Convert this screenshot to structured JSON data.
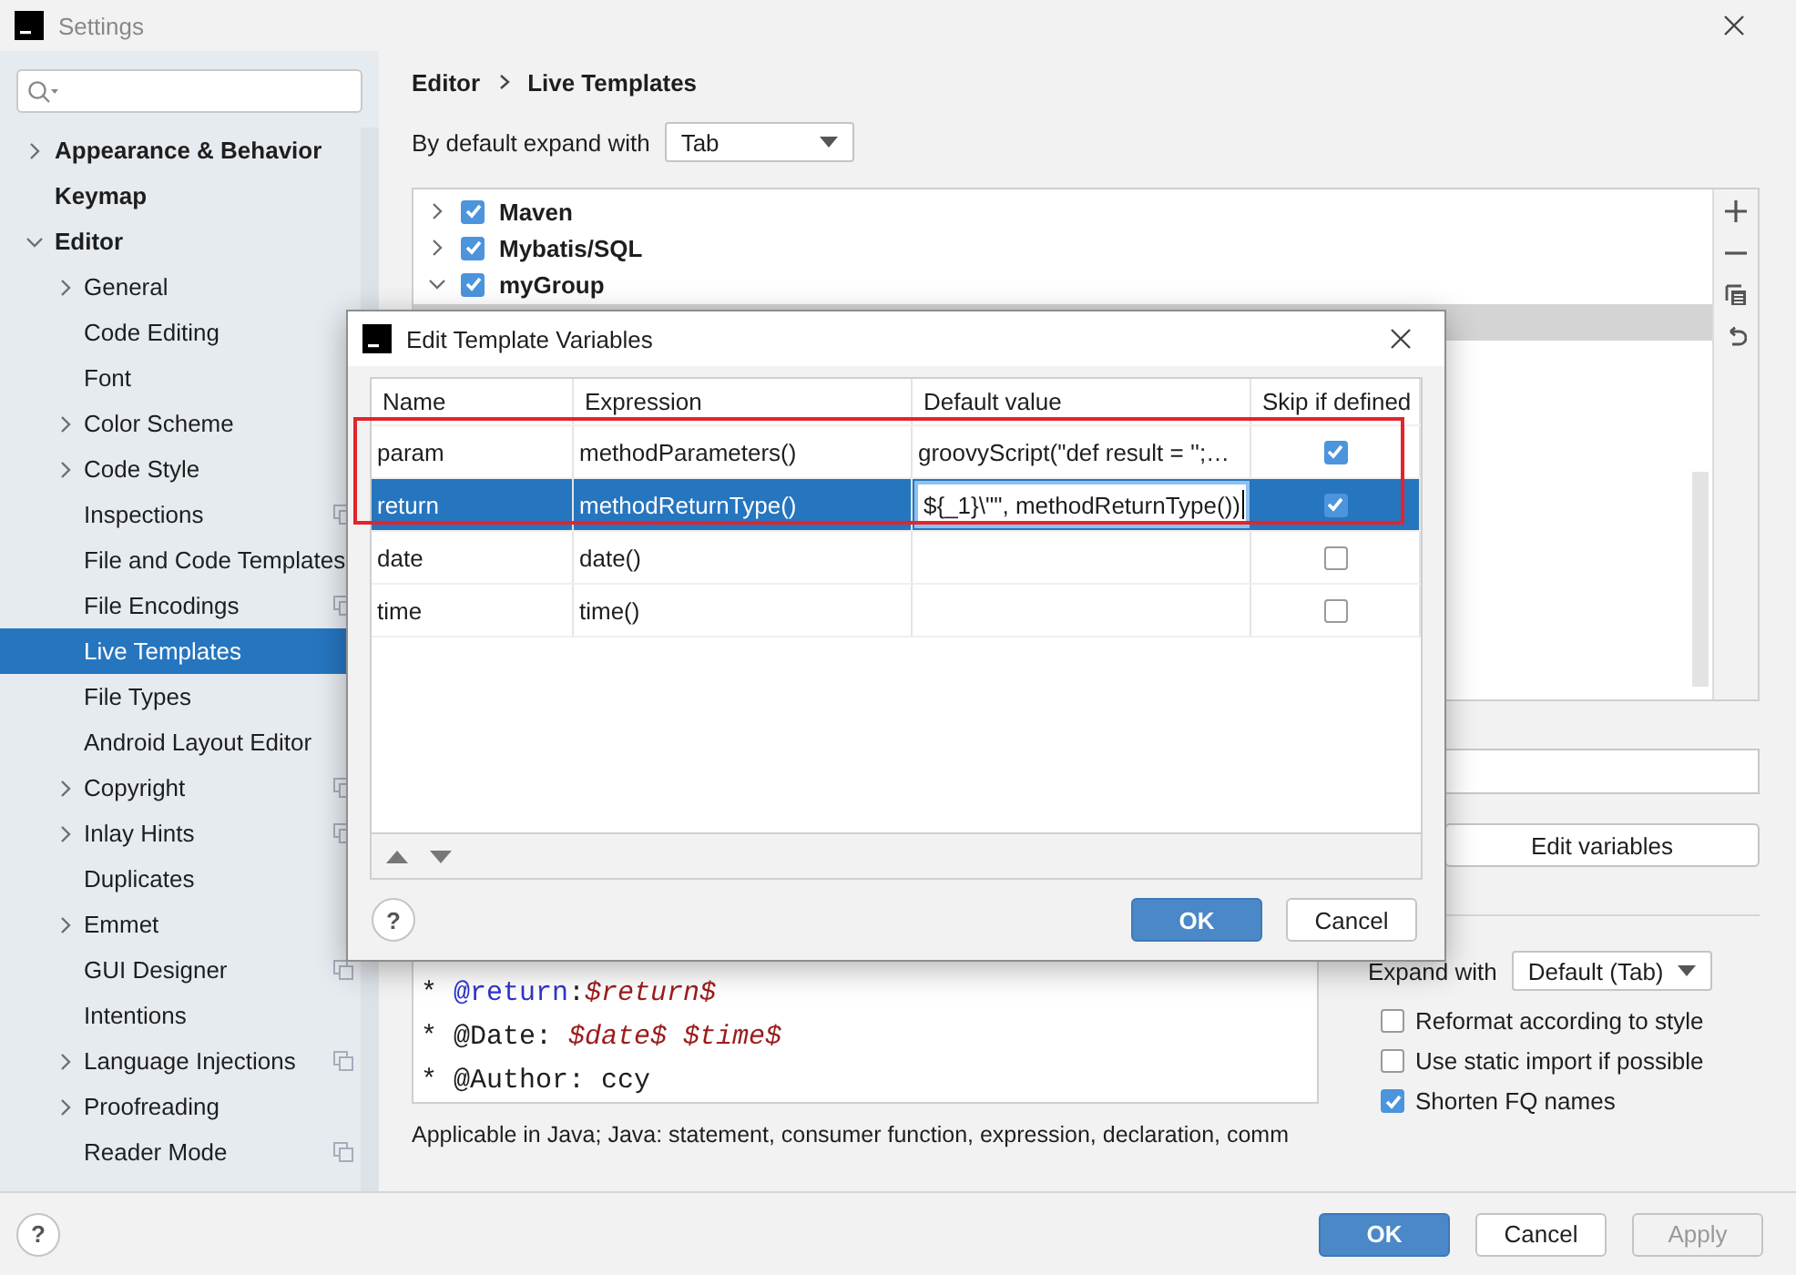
{
  "window": {
    "title": "Settings",
    "help": "?"
  },
  "sidebar": {
    "items": [
      {
        "label": "Appearance & Behavior",
        "expanded": false,
        "selected": false
      },
      {
        "label": "Keymap",
        "selected": false
      },
      {
        "label": "Editor",
        "expanded": true,
        "selected": false,
        "children": [
          {
            "label": "General",
            "expanded": false,
            "selected": false,
            "project_icon": false
          },
          {
            "label": "Code Editing",
            "selected": false,
            "project_icon": false
          },
          {
            "label": "Font",
            "selected": false,
            "project_icon": false
          },
          {
            "label": "Color Scheme",
            "expanded": false,
            "selected": false,
            "project_icon": false
          },
          {
            "label": "Code Style",
            "expanded": false,
            "selected": false,
            "project_icon": false
          },
          {
            "label": "Inspections",
            "selected": false,
            "project_icon": true
          },
          {
            "label": "File and Code Templates",
            "selected": false,
            "project_icon": false
          },
          {
            "label": "File Encodings",
            "selected": false,
            "project_icon": true
          },
          {
            "label": "Live Templates",
            "selected": true,
            "project_icon": false
          },
          {
            "label": "File Types",
            "selected": false,
            "project_icon": false
          },
          {
            "label": "Android Layout Editor",
            "selected": false,
            "project_icon": false
          },
          {
            "label": "Copyright",
            "expanded": false,
            "selected": false,
            "project_icon": true
          },
          {
            "label": "Inlay Hints",
            "expanded": false,
            "selected": false,
            "project_icon": true
          },
          {
            "label": "Duplicates",
            "selected": false,
            "project_icon": false
          },
          {
            "label": "Emmet",
            "expanded": false,
            "selected": false,
            "project_icon": false
          },
          {
            "label": "GUI Designer",
            "selected": false,
            "project_icon": true
          },
          {
            "label": "Intentions",
            "selected": false,
            "project_icon": false
          },
          {
            "label": "Language Injections",
            "expanded": false,
            "selected": false,
            "project_icon": true
          },
          {
            "label": "Proofreading",
            "expanded": false,
            "selected": false,
            "project_icon": false
          },
          {
            "label": "Reader Mode",
            "selected": false,
            "project_icon": true
          }
        ]
      }
    ]
  },
  "breadcrumb": [
    "Editor",
    "Live Templates"
  ],
  "expand_default": {
    "label": "By default expand with",
    "value": "Tab"
  },
  "template_groups": [
    {
      "label": "Maven",
      "expanded": false,
      "checked": true
    },
    {
      "label": "Mybatis/SQL",
      "expanded": false,
      "checked": true
    },
    {
      "label": "myGroup",
      "expanded": true,
      "checked": true
    }
  ],
  "edit_variables_button": "Edit variables",
  "template_text": [
    [
      {
        "kind": "plain",
        "text": "* "
      },
      {
        "kind": "tag",
        "text": "@return"
      },
      {
        "kind": "plain",
        "text": ":"
      },
      {
        "kind": "variable",
        "text": "$return$"
      }
    ],
    [
      {
        "kind": "plain",
        "text": "* @Date: "
      },
      {
        "kind": "variable",
        "text": "$date$ $time$"
      }
    ],
    [
      {
        "kind": "plain",
        "text": "* @Author: ccy"
      }
    ]
  ],
  "applicable": "Applicable in Java; Java: statement, consumer function, expression, declaration, comm",
  "options": {
    "expand_with": {
      "label": "Expand with",
      "value": "Default (Tab)"
    },
    "checkboxes": [
      {
        "label": "Reformat according to style",
        "checked": false
      },
      {
        "label": "Use static import if possible",
        "checked": false
      },
      {
        "label": "Shorten FQ names",
        "checked": true
      }
    ]
  },
  "buttons": [
    {
      "label": "OK",
      "kind": "primary",
      "disabled": false
    },
    {
      "label": "Cancel",
      "kind": "normal",
      "disabled": false
    },
    {
      "label": "Apply",
      "kind": "normal",
      "disabled": true
    }
  ],
  "dialog": {
    "title": "Edit Template Variables",
    "help": "?",
    "columns": [
      "Name",
      "Expression",
      "Default value",
      "Skip if defined"
    ],
    "rows": [
      {
        "name": "param",
        "expression": "methodParameters()",
        "default_value": "groovyScript(\"def result = '';…",
        "skip_if_defined": true,
        "selected": false,
        "editing": false
      },
      {
        "name": "return",
        "expression": "methodReturnType()",
        "default_value": "${_1}\\\"\", methodReturnType())",
        "skip_if_defined": true,
        "selected": true,
        "editing": true
      },
      {
        "name": "date",
        "expression": "date()",
        "default_value": "",
        "skip_if_defined": false,
        "selected": false,
        "editing": false
      },
      {
        "name": "time",
        "expression": "time()",
        "default_value": "",
        "skip_if_defined": false,
        "selected": false,
        "editing": false
      }
    ],
    "buttons": [
      {
        "label": "OK",
        "kind": "primary"
      },
      {
        "label": "Cancel",
        "kind": "normal"
      }
    ]
  }
}
